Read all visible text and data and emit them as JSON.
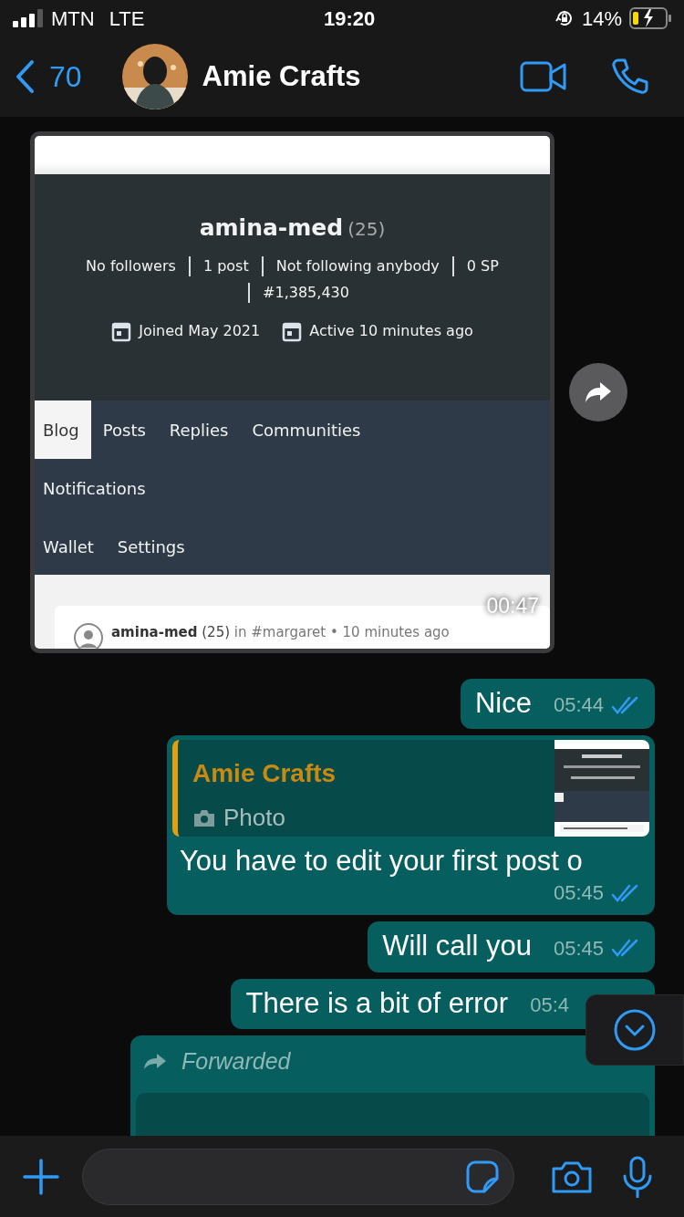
{
  "status_bar": {
    "carrier": "MTN",
    "network": "LTE",
    "time": "19:20",
    "battery": "14%",
    "charging": true
  },
  "header": {
    "back_count": "70",
    "contact_name": "Amie Crafts"
  },
  "messages": [
    {
      "outgoing": false,
      "duration": "00:47",
      "screenshot": {
        "username": "amina-med",
        "reputation": "(25)",
        "stats": [
          "No followers",
          "1 post",
          "Not following anybody",
          "0 SP",
          "#1,385,430"
        ],
        "joined": "Joined May 2021",
        "active": "Active 10 minutes ago",
        "tab_rows": [
          [
            {
              "label": "Blog",
              "selected": true
            },
            {
              "label": "Posts",
              "selected": false
            },
            {
              "label": "Replies",
              "selected": false
            },
            {
              "label": "Communities",
              "selected": false
            }
          ],
          [
            {
              "label": "Notifications",
              "selected": false
            }
          ],
          [
            {
              "label": "Wallet",
              "selected": false
            },
            {
              "label": "Settings",
              "selected": false
            }
          ]
        ],
        "post": {
          "author": "amina-med",
          "reputation": "(25)",
          "meta": "in #margaret • 10 minutes ago"
        }
      }
    },
    {
      "kind": "text",
      "outgoing": true,
      "text": "Nice",
      "time": "05:44",
      "read": true
    },
    {
      "kind": "reply",
      "outgoing": true,
      "quote": {
        "author": "Amie Crafts",
        "label": "Photo"
      },
      "text": "You have to edit your first post o",
      "time": "05:45",
      "read": true
    },
    {
      "kind": "text",
      "outgoing": true,
      "text": "Will call you",
      "time": "05:45",
      "read": true
    },
    {
      "kind": "text",
      "outgoing": true,
      "text": "There is a bit of error",
      "time": "05:4"
    },
    {
      "kind": "forwarded",
      "outgoing": true,
      "label": "Forwarded"
    }
  ]
}
